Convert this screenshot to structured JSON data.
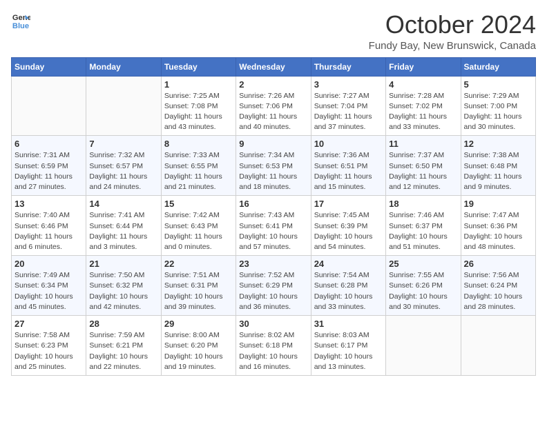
{
  "header": {
    "logo_line1": "General",
    "logo_line2": "Blue",
    "month": "October 2024",
    "location": "Fundy Bay, New Brunswick, Canada"
  },
  "weekdays": [
    "Sunday",
    "Monday",
    "Tuesday",
    "Wednesday",
    "Thursday",
    "Friday",
    "Saturday"
  ],
  "weeks": [
    [
      {
        "day": null
      },
      {
        "day": null
      },
      {
        "day": "1",
        "sunrise": "Sunrise: 7:25 AM",
        "sunset": "Sunset: 7:08 PM",
        "daylight": "Daylight: 11 hours and 43 minutes."
      },
      {
        "day": "2",
        "sunrise": "Sunrise: 7:26 AM",
        "sunset": "Sunset: 7:06 PM",
        "daylight": "Daylight: 11 hours and 40 minutes."
      },
      {
        "day": "3",
        "sunrise": "Sunrise: 7:27 AM",
        "sunset": "Sunset: 7:04 PM",
        "daylight": "Daylight: 11 hours and 37 minutes."
      },
      {
        "day": "4",
        "sunrise": "Sunrise: 7:28 AM",
        "sunset": "Sunset: 7:02 PM",
        "daylight": "Daylight: 11 hours and 33 minutes."
      },
      {
        "day": "5",
        "sunrise": "Sunrise: 7:29 AM",
        "sunset": "Sunset: 7:00 PM",
        "daylight": "Daylight: 11 hours and 30 minutes."
      }
    ],
    [
      {
        "day": "6",
        "sunrise": "Sunrise: 7:31 AM",
        "sunset": "Sunset: 6:59 PM",
        "daylight": "Daylight: 11 hours and 27 minutes."
      },
      {
        "day": "7",
        "sunrise": "Sunrise: 7:32 AM",
        "sunset": "Sunset: 6:57 PM",
        "daylight": "Daylight: 11 hours and 24 minutes."
      },
      {
        "day": "8",
        "sunrise": "Sunrise: 7:33 AM",
        "sunset": "Sunset: 6:55 PM",
        "daylight": "Daylight: 11 hours and 21 minutes."
      },
      {
        "day": "9",
        "sunrise": "Sunrise: 7:34 AM",
        "sunset": "Sunset: 6:53 PM",
        "daylight": "Daylight: 11 hours and 18 minutes."
      },
      {
        "day": "10",
        "sunrise": "Sunrise: 7:36 AM",
        "sunset": "Sunset: 6:51 PM",
        "daylight": "Daylight: 11 hours and 15 minutes."
      },
      {
        "day": "11",
        "sunrise": "Sunrise: 7:37 AM",
        "sunset": "Sunset: 6:50 PM",
        "daylight": "Daylight: 11 hours and 12 minutes."
      },
      {
        "day": "12",
        "sunrise": "Sunrise: 7:38 AM",
        "sunset": "Sunset: 6:48 PM",
        "daylight": "Daylight: 11 hours and 9 minutes."
      }
    ],
    [
      {
        "day": "13",
        "sunrise": "Sunrise: 7:40 AM",
        "sunset": "Sunset: 6:46 PM",
        "daylight": "Daylight: 11 hours and 6 minutes."
      },
      {
        "day": "14",
        "sunrise": "Sunrise: 7:41 AM",
        "sunset": "Sunset: 6:44 PM",
        "daylight": "Daylight: 11 hours and 3 minutes."
      },
      {
        "day": "15",
        "sunrise": "Sunrise: 7:42 AM",
        "sunset": "Sunset: 6:43 PM",
        "daylight": "Daylight: 11 hours and 0 minutes."
      },
      {
        "day": "16",
        "sunrise": "Sunrise: 7:43 AM",
        "sunset": "Sunset: 6:41 PM",
        "daylight": "Daylight: 10 hours and 57 minutes."
      },
      {
        "day": "17",
        "sunrise": "Sunrise: 7:45 AM",
        "sunset": "Sunset: 6:39 PM",
        "daylight": "Daylight: 10 hours and 54 minutes."
      },
      {
        "day": "18",
        "sunrise": "Sunrise: 7:46 AM",
        "sunset": "Sunset: 6:37 PM",
        "daylight": "Daylight: 10 hours and 51 minutes."
      },
      {
        "day": "19",
        "sunrise": "Sunrise: 7:47 AM",
        "sunset": "Sunset: 6:36 PM",
        "daylight": "Daylight: 10 hours and 48 minutes."
      }
    ],
    [
      {
        "day": "20",
        "sunrise": "Sunrise: 7:49 AM",
        "sunset": "Sunset: 6:34 PM",
        "daylight": "Daylight: 10 hours and 45 minutes."
      },
      {
        "day": "21",
        "sunrise": "Sunrise: 7:50 AM",
        "sunset": "Sunset: 6:32 PM",
        "daylight": "Daylight: 10 hours and 42 minutes."
      },
      {
        "day": "22",
        "sunrise": "Sunrise: 7:51 AM",
        "sunset": "Sunset: 6:31 PM",
        "daylight": "Daylight: 10 hours and 39 minutes."
      },
      {
        "day": "23",
        "sunrise": "Sunrise: 7:52 AM",
        "sunset": "Sunset: 6:29 PM",
        "daylight": "Daylight: 10 hours and 36 minutes."
      },
      {
        "day": "24",
        "sunrise": "Sunrise: 7:54 AM",
        "sunset": "Sunset: 6:28 PM",
        "daylight": "Daylight: 10 hours and 33 minutes."
      },
      {
        "day": "25",
        "sunrise": "Sunrise: 7:55 AM",
        "sunset": "Sunset: 6:26 PM",
        "daylight": "Daylight: 10 hours and 30 minutes."
      },
      {
        "day": "26",
        "sunrise": "Sunrise: 7:56 AM",
        "sunset": "Sunset: 6:24 PM",
        "daylight": "Daylight: 10 hours and 28 minutes."
      }
    ],
    [
      {
        "day": "27",
        "sunrise": "Sunrise: 7:58 AM",
        "sunset": "Sunset: 6:23 PM",
        "daylight": "Daylight: 10 hours and 25 minutes."
      },
      {
        "day": "28",
        "sunrise": "Sunrise: 7:59 AM",
        "sunset": "Sunset: 6:21 PM",
        "daylight": "Daylight: 10 hours and 22 minutes."
      },
      {
        "day": "29",
        "sunrise": "Sunrise: 8:00 AM",
        "sunset": "Sunset: 6:20 PM",
        "daylight": "Daylight: 10 hours and 19 minutes."
      },
      {
        "day": "30",
        "sunrise": "Sunrise: 8:02 AM",
        "sunset": "Sunset: 6:18 PM",
        "daylight": "Daylight: 10 hours and 16 minutes."
      },
      {
        "day": "31",
        "sunrise": "Sunrise: 8:03 AM",
        "sunset": "Sunset: 6:17 PM",
        "daylight": "Daylight: 10 hours and 13 minutes."
      },
      {
        "day": null
      },
      {
        "day": null
      }
    ]
  ]
}
